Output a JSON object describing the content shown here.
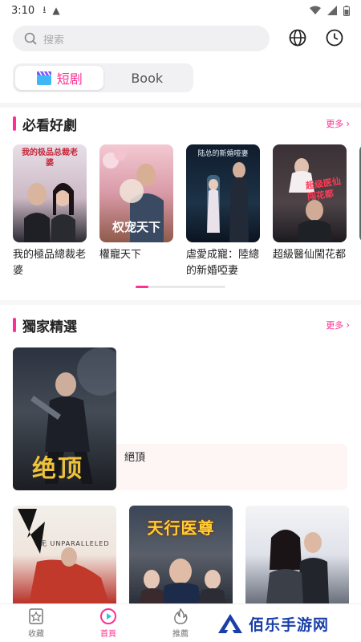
{
  "status_bar": {
    "time": "3:10"
  },
  "search": {
    "placeholder": "搜索"
  },
  "tabs": [
    {
      "label": "短剧",
      "active": true
    },
    {
      "label": "Book",
      "active": false
    }
  ],
  "sections": {
    "must_watch": {
      "title": "必看好劇",
      "more": "更多"
    },
    "exclusive": {
      "title": "獨家精選",
      "more": "更多"
    }
  },
  "must_watch_items": [
    {
      "title": "我的極品總裁老婆",
      "poster_text": "我的极品总裁老婆"
    },
    {
      "title": "權寵天下",
      "poster_text": "权宠天下"
    },
    {
      "title": "虐愛成寵：陸總的新婚啞妻",
      "poster_text": "陆总的新婚哑妻"
    },
    {
      "title": "超級醫仙闖花都",
      "poster_text": "超级医仙闯花都"
    }
  ],
  "exclusive_feature": {
    "title": "絕頂",
    "poster_text": "绝顶"
  },
  "exclusive_grid": [
    {
      "poster_text": "无 UNPARALLELED"
    },
    {
      "poster_text": "天行医尊"
    },
    {
      "poster_text": ""
    }
  ],
  "bottom_nav": [
    {
      "label": "收藏",
      "icon": "star-icon",
      "active": false
    },
    {
      "label": "首頁",
      "icon": "play-circle-icon",
      "active": true
    },
    {
      "label": "推薦",
      "icon": "flame-icon",
      "active": false
    }
  ],
  "watermark": {
    "text": "佰乐手游网"
  },
  "colors": {
    "accent": "#ff2f92",
    "search_bg": "#f0f0f2",
    "watermark": "#1a3fa8"
  }
}
